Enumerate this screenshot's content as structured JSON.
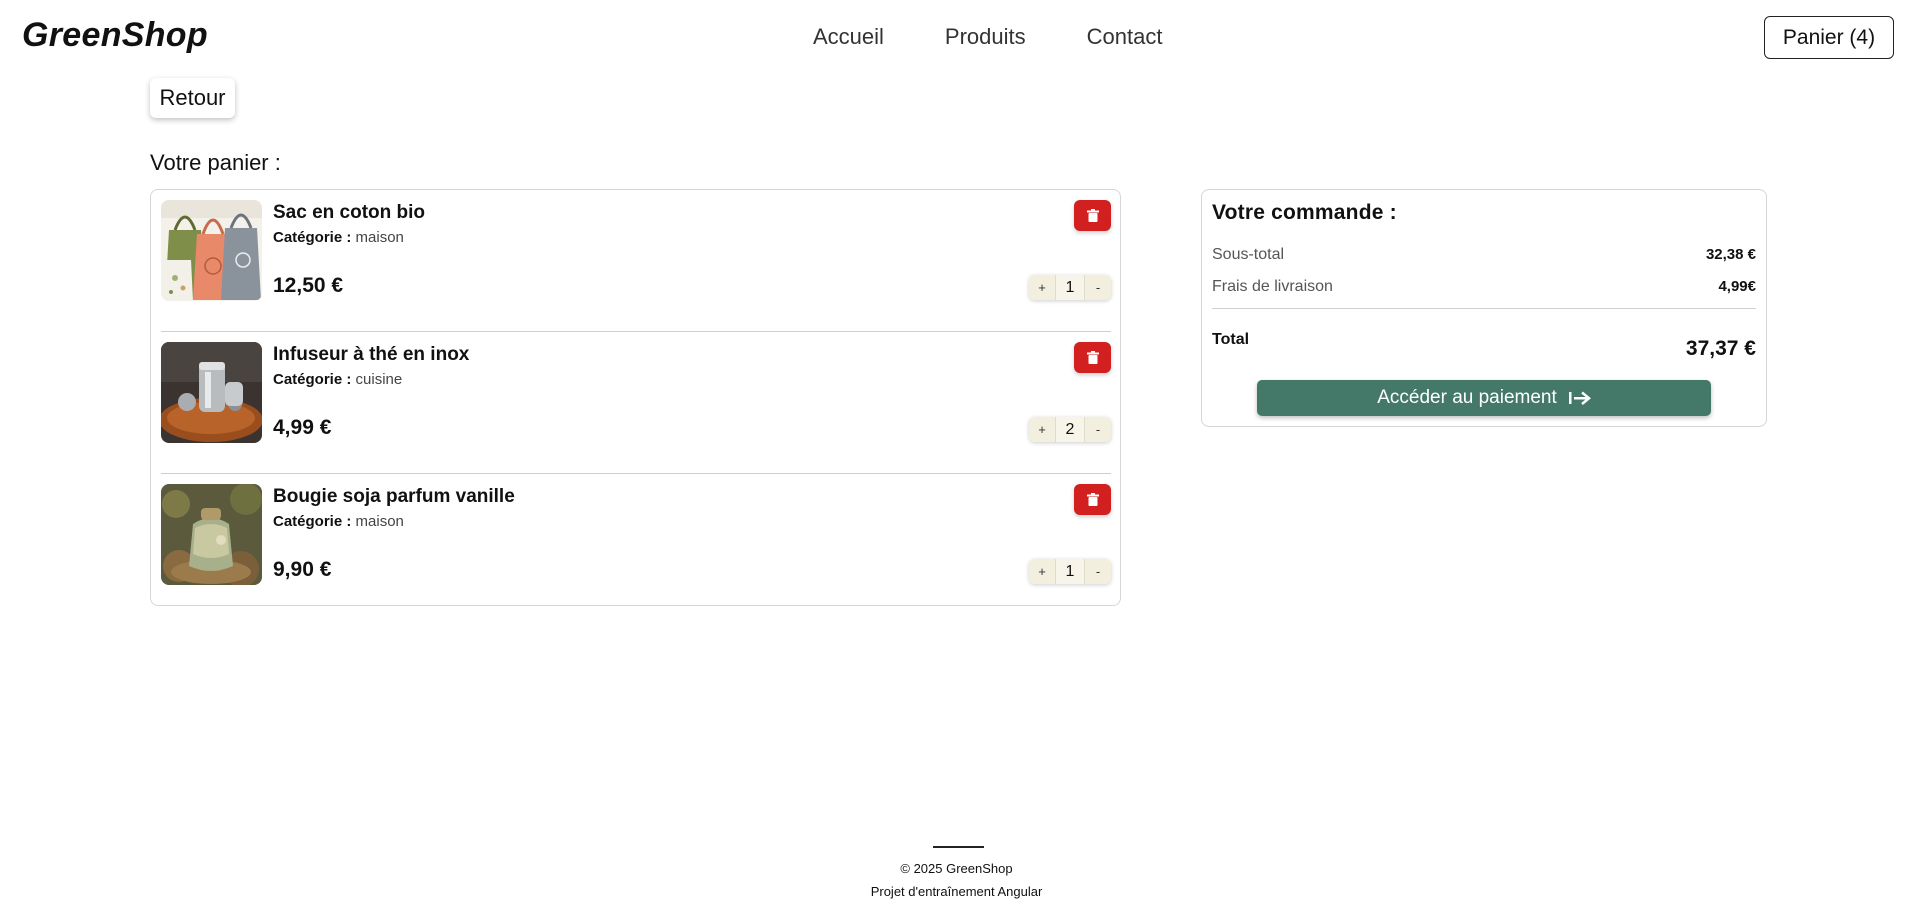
{
  "header": {
    "logo": "GreenShop",
    "nav": [
      "Accueil",
      "Produits",
      "Contact"
    ],
    "cart_button": "Panier (4)"
  },
  "back_button": "Retour",
  "cart_title": "Votre panier :",
  "category_label": "Catégorie :",
  "items": [
    {
      "name": "Sac en coton bio",
      "category": "maison",
      "price": "12,50 €",
      "quantity": "1",
      "plus": "+",
      "minus": "-",
      "image": "tote-bags-photo"
    },
    {
      "name": "Infuseur à thé en inox",
      "category": "cuisine",
      "price": "4,99 €",
      "quantity": "2",
      "plus": "+",
      "minus": "-",
      "image": "tea-infuser-photo"
    },
    {
      "name": "Bougie soja parfum vanille",
      "category": "maison",
      "price": "9,90 €",
      "quantity": "1",
      "plus": "+",
      "minus": "-",
      "image": "candle-photo"
    }
  ],
  "summary": {
    "title": "Votre commande :",
    "subtotal_label": "Sous-total",
    "subtotal_value": "32,38 €",
    "shipping_label": "Frais de livraison",
    "shipping_value": "4,99€",
    "total_label": "Total",
    "total_value": "37,37 €",
    "pay_button": "Accéder au paiement"
  },
  "footer": {
    "copyright": "© 2025 GreenShop",
    "subtitle": "Projet d'entraînement Angular"
  },
  "colors": {
    "accent": "#44796a",
    "danger": "#d21f1f",
    "qty_bg": "#f3efdf"
  }
}
